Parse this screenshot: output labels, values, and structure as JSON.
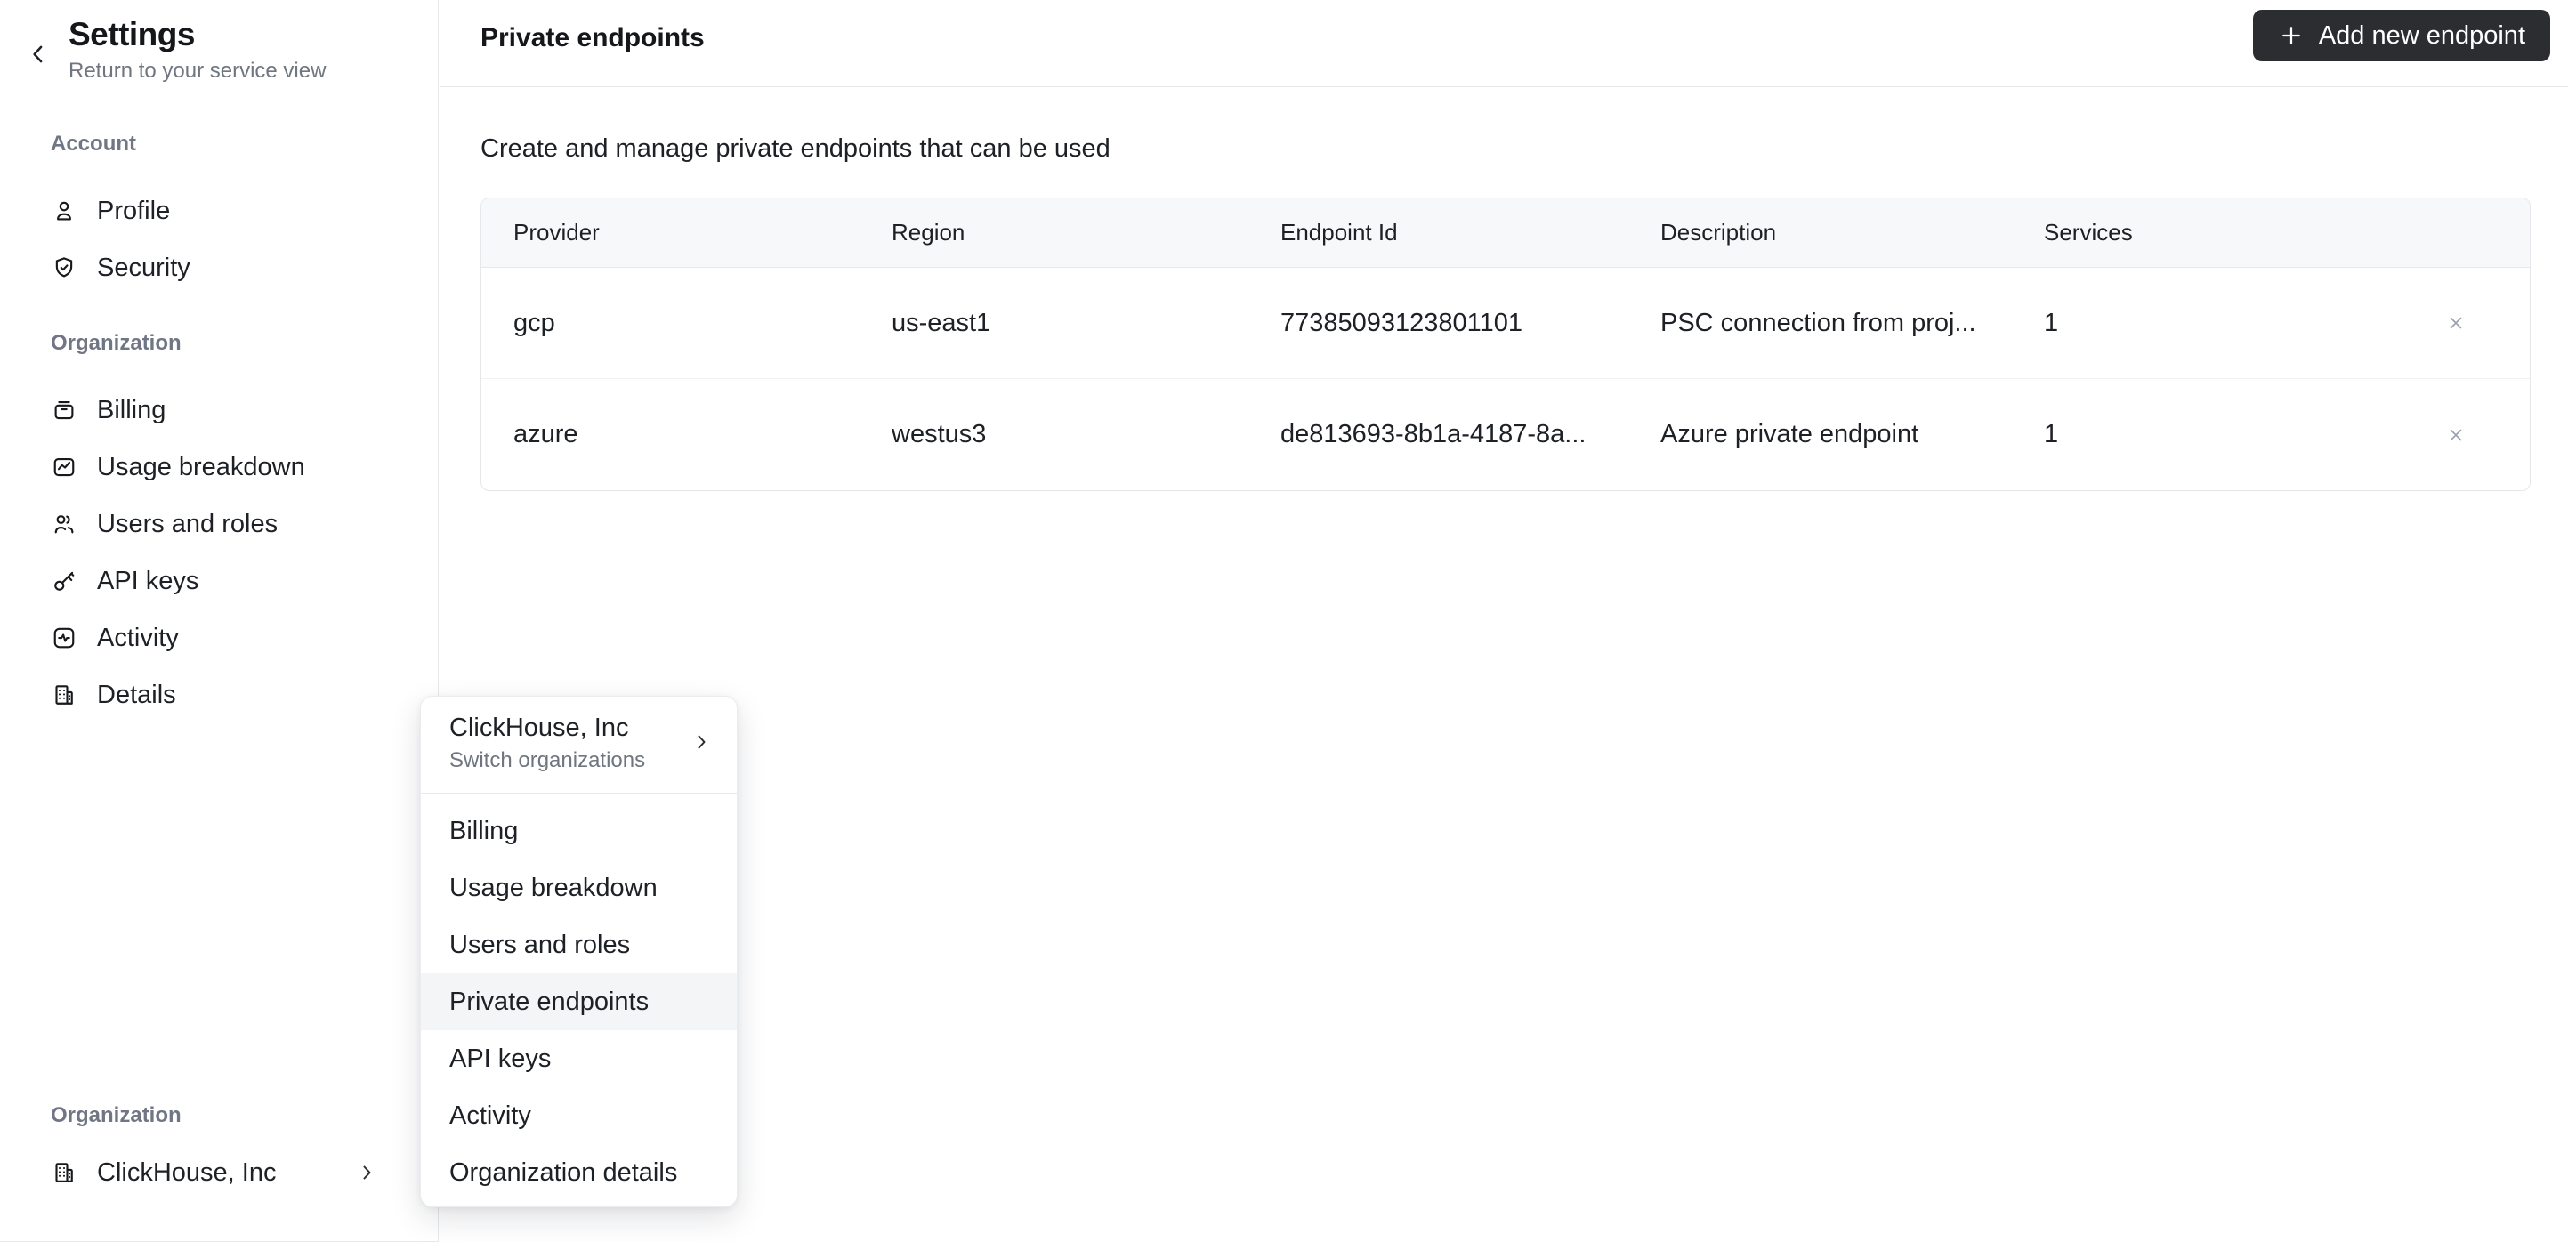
{
  "sidebar": {
    "title": "Settings",
    "subtitle": "Return to your service view",
    "back_icon": "chevron-left-icon",
    "account_label": "Account",
    "account_items": [
      {
        "label": "Profile",
        "icon": "user-icon"
      },
      {
        "label": "Security",
        "icon": "shield-check-icon"
      }
    ],
    "organization_label": "Organization",
    "organization_items": [
      {
        "label": "Billing",
        "icon": "billing-icon"
      },
      {
        "label": "Usage breakdown",
        "icon": "usage-chart-icon"
      },
      {
        "label": "Users and roles",
        "icon": "users-icon"
      },
      {
        "label": "API keys",
        "icon": "key-icon"
      },
      {
        "label": "Activity",
        "icon": "activity-icon"
      },
      {
        "label": "Details",
        "icon": "building-icon"
      }
    ],
    "footer_label": "Organization",
    "footer_org": {
      "name": "ClickHouse, Inc",
      "icon": "building-icon",
      "chevron": "chevron-right-icon"
    }
  },
  "header": {
    "title": "Private endpoints",
    "add_button_label": "Add new endpoint",
    "add_button_icon": "plus-icon"
  },
  "main": {
    "description": "Create and manage private endpoints that can be used",
    "table": {
      "columns": [
        "Provider",
        "Region",
        "Endpoint Id",
        "Description",
        "Services"
      ],
      "row_action_icon": "close-icon",
      "rows": [
        {
          "provider": "gcp",
          "region": "us-east1",
          "endpoint_id": "77385093123801101",
          "description": "PSC connection from proj...",
          "services": "1"
        },
        {
          "provider": "azure",
          "region": "westus3",
          "endpoint_id": "de813693-8b1a-4187-8a...",
          "description": "Azure private endpoint",
          "services": "1"
        }
      ]
    }
  },
  "dropdown": {
    "org_name": "ClickHouse, Inc",
    "org_subtitle": "Switch organizations",
    "chevron_icon": "chevron-right-icon",
    "items": [
      {
        "label": "Billing"
      },
      {
        "label": "Usage breakdown"
      },
      {
        "label": "Users and roles"
      },
      {
        "label": "Private endpoints"
      },
      {
        "label": "API keys"
      },
      {
        "label": "Activity"
      },
      {
        "label": "Organization details"
      }
    ],
    "active_item": "Private endpoints"
  },
  "colors": {
    "button_bg": "#2b2d31",
    "button_text": "#ffffff",
    "table_header_bg": "#f7f8fa",
    "active_item_bg": "#f4f5f7",
    "border": "#e6e8ea",
    "text_primary": "#1d2025",
    "text_secondary": "#6f7680",
    "close_icon": "#9aa1aa"
  }
}
